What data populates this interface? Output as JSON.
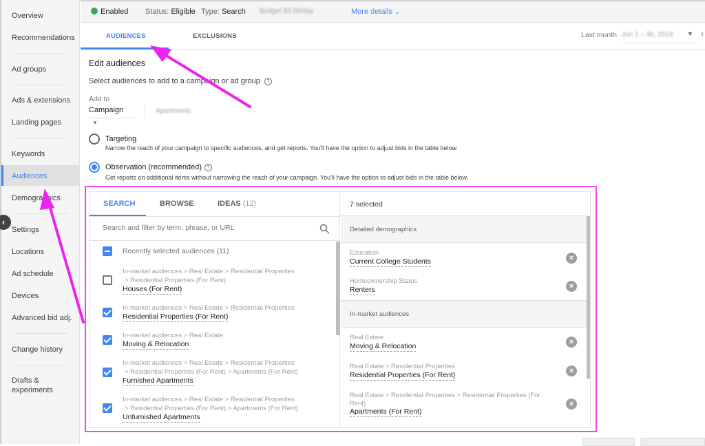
{
  "sidebar": {
    "items": [
      {
        "label": "Overview",
        "active": false
      },
      {
        "label": "Recommendations",
        "active": false
      },
      {
        "label": "Ad groups",
        "active": false
      },
      {
        "label": "Ads & extensions",
        "active": false
      },
      {
        "label": "Landing pages",
        "active": false
      },
      {
        "label": "Keywords",
        "active": false
      },
      {
        "label": "Audiences",
        "active": true
      },
      {
        "label": "Demographics",
        "active": false
      },
      {
        "label": "Settings",
        "active": false
      },
      {
        "label": "Locations",
        "active": false
      },
      {
        "label": "Ad schedule",
        "active": false
      },
      {
        "label": "Devices",
        "active": false
      },
      {
        "label": "Advanced bid adj.",
        "active": false
      },
      {
        "label": "Change history",
        "active": false
      },
      {
        "label": "Drafts & experiments",
        "active": false
      }
    ],
    "collapse_icon": "chevron-left-icon"
  },
  "status_bar": {
    "enabled_label": "Enabled",
    "status_key": "Status:",
    "status_value": "Eligible",
    "type_key": "Type:",
    "type_value": "Search",
    "budget_blurred": "Budget $3.00/day",
    "more_details": "More details"
  },
  "tabs": {
    "items": [
      {
        "label": "AUDIENCES",
        "active": true
      },
      {
        "label": "EXCLUSIONS",
        "active": false
      }
    ],
    "date_label": "Last month",
    "date_range_blurred": "Jun 1 – 30, 2019"
  },
  "main": {
    "title": "Edit audiences",
    "subtitle": "Select audiences to add to a campaign or ad group",
    "add_to_label": "Add to",
    "add_to_value": "Campaign",
    "campaign_name_blurred": "Apartments",
    "options": [
      {
        "label": "Targeting",
        "description": "Narrow the reach of your campaign to specific audiences, and get reports. You'll have the option to adjust bids in the table below.",
        "selected": false
      },
      {
        "label": "Observation (recommended)",
        "description": "Get reports on additional items without narrowing the reach of your campaign. You'll have the option to adjust bids in the table below.",
        "selected": true
      }
    ]
  },
  "picker": {
    "tabs": [
      {
        "label": "SEARCH",
        "count": "",
        "active": true
      },
      {
        "label": "BROWSE",
        "count": "",
        "active": false
      },
      {
        "label": "IDEAS",
        "count": "(12)",
        "active": false
      }
    ],
    "search_placeholder": "Search and filter by term, phrase, or URL",
    "recent_label": "Recently selected audiences (11)",
    "results": [
      {
        "crumb1": "In-market audiences > Real Estate > Residential Properties",
        "crumb2": "> Residential Properties (For Rent)",
        "name": "Houses (For Rent)",
        "checked": false
      },
      {
        "crumb1": "In-market audiences > Real Estate > Residential Properties",
        "crumb2": "",
        "name": "Residential Properties (For Rent)",
        "checked": true
      },
      {
        "crumb1": "In-market audiences > Real Estate",
        "crumb2": "",
        "name": "Moving & Relocation",
        "checked": true
      },
      {
        "crumb1": "In-market audiences > Real Estate > Residential Properties",
        "crumb2": "> Residential Properties (For Rent) > Apartments (For Rent)",
        "name": "Furnished Apartments",
        "checked": true
      },
      {
        "crumb1": "In-market audiences > Real Estate > Residential Properties",
        "crumb2": "> Residential Properties (For Rent) > Apartments (For Rent)",
        "name": "Unfurnished Apartments",
        "checked": true
      }
    ],
    "selected_count": "7 selected",
    "sections": [
      {
        "title": "Detailed demographics",
        "items": [
          {
            "crumb": "Education",
            "name": "Current College Students"
          },
          {
            "crumb": "Homeownership Status",
            "name": "Renters"
          }
        ]
      },
      {
        "title": "In-market audiences",
        "items": [
          {
            "crumb": "Real Estate",
            "name": "Moving & Relocation"
          },
          {
            "crumb": "Real Estate > Residential Properties",
            "name": "Residential Properties (For Rent)"
          },
          {
            "crumb": "Real Estate > Residential Properties > Residential Properties (For Rent)",
            "name": "Apartments (For Rent)"
          }
        ]
      }
    ]
  },
  "colors": {
    "accent": "#4285f4",
    "enabled_green": "#34a853",
    "annotation_magenta": "#ee44ee"
  }
}
